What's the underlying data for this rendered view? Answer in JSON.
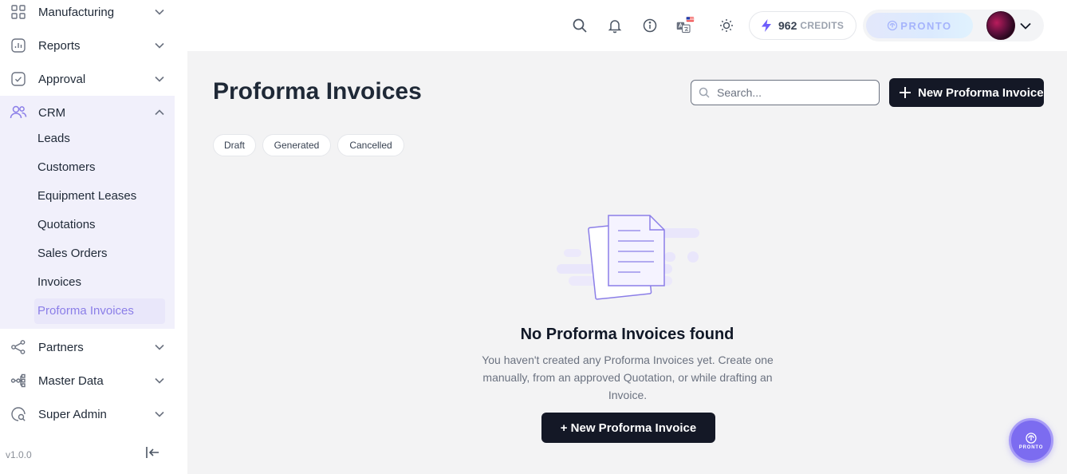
{
  "sidebar": {
    "items_top": [
      {
        "label": "Manufacturing",
        "icon": "grid-icon"
      },
      {
        "label": "Reports",
        "icon": "report-icon"
      },
      {
        "label": "Approval",
        "icon": "check-square-icon"
      },
      {
        "label": "CRM",
        "icon": "users-icon"
      }
    ],
    "crm_sub": [
      "Leads",
      "Customers",
      "Equipment Leases",
      "Quotations",
      "Sales Orders",
      "Invoices",
      "Proforma Invoices"
    ],
    "items_bottom": [
      {
        "label": "Partners",
        "icon": "share-icon"
      },
      {
        "label": "Master Data",
        "icon": "hierarchy-icon"
      },
      {
        "label": "Super Admin",
        "icon": "admin-search-icon"
      }
    ],
    "version": "v1.0.0"
  },
  "header": {
    "credits_value": "962",
    "credits_label": "CREDITS",
    "brand": "PRONTO"
  },
  "main": {
    "title": "Proforma Invoices",
    "search_placeholder": "Search...",
    "new_button": "New Proforma Invoice",
    "filters": [
      "Draft",
      "Generated",
      "Cancelled"
    ],
    "empty_title": "No Proforma Invoices found",
    "empty_desc": "You haven't created any Proforma Invoices yet. Create one manually, from an approved Quotation, or while drafting an Invoice.",
    "empty_button": "+ New Proforma Invoice"
  },
  "fab": {
    "label": "PRONTO"
  },
  "colors": {
    "accent": "#8b7ee8",
    "dark_button": "#141826",
    "crm_bg": "#f1f0fb",
    "main_bg": "#f3f3f4"
  }
}
